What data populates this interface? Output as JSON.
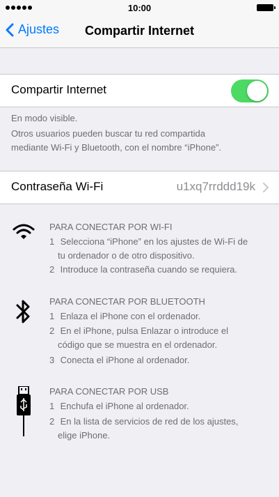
{
  "status": {
    "time": "10:00"
  },
  "nav": {
    "back_label": "Ajustes",
    "title": "Compartir Internet"
  },
  "hotspot": {
    "label": "Compartir Internet",
    "enabled": true
  },
  "footer": {
    "line1": "En modo visible.",
    "line2": "Otros usuarios pueden buscar tu red compartida",
    "line3": "mediante Wi-Fi y Bluetooth, con el nombre “iPhone”."
  },
  "password": {
    "label": "Contraseña Wi-Fi",
    "value": "u1xq7rrddd19k"
  },
  "wifi": {
    "heading": "PARA CONECTAR POR WI-FI",
    "steps": [
      {
        "n": "1",
        "a": "Selecciona “iPhone” en los ajustes de Wi-Fi de",
        "b": "tu ordenador o de otro dispositivo."
      },
      {
        "n": "2",
        "a": "Introduce la contraseña cuando se requiera."
      }
    ]
  },
  "bluetooth": {
    "heading": "PARA CONECTAR POR BLUETOOTH",
    "steps": [
      {
        "n": "1",
        "a": "Enlaza el iPhone con el ordenador."
      },
      {
        "n": "2",
        "a": "En el iPhone, pulsa Enlazar o introduce el",
        "b": "código que se muestra en el ordenador."
      },
      {
        "n": "3",
        "a": "Conecta el iPhone al ordenador."
      }
    ]
  },
  "usb": {
    "heading": "PARA CONECTAR POR USB",
    "steps": [
      {
        "n": "1",
        "a": "Enchufa el iPhone al ordenador."
      },
      {
        "n": "2",
        "a": "En la lista de servicios de red de los ajustes,",
        "b": "elige iPhone."
      }
    ]
  },
  "colors": {
    "accent": "#007aff",
    "toggle_on": "#4cd964",
    "background": "#efeff4"
  },
  "icons": [
    "chevron-left-icon",
    "chevron-right-icon",
    "wifi-icon",
    "bluetooth-icon",
    "usb-icon",
    "battery-icon",
    "signal-icon"
  ]
}
